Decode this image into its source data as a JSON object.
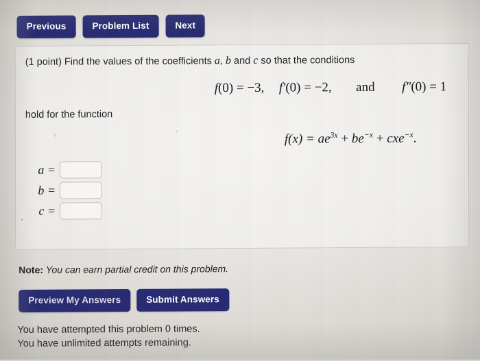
{
  "nav": {
    "previous_label": "Previous",
    "problem_list_label": "Problem List",
    "next_label": "Next"
  },
  "problem": {
    "points_prefix": "(1 point) Find the values of the coefficients",
    "var_a": "a",
    "comma": ",",
    "var_b": "b",
    "and_word": "and",
    "var_c": "c",
    "prompt_suffix": "so that the conditions",
    "conditions": {
      "cond1_fn": "f",
      "cond1_arg": "(0) = −3,",
      "cond2_fn": "f",
      "cond2_prime": "′",
      "cond2_arg": "(0) = −2,",
      "joiner": "and",
      "cond3_fn": "f",
      "cond3_prime": "″",
      "cond3_arg": "(0) = 1",
      "plain_text": "f(0) = −3,   f′(0) = −2,   and   f″(0) = 1"
    },
    "hold_text": "hold for the function",
    "function": {
      "lhs": "f",
      "lhs_arg": "(x) = ",
      "term1_coeff": "ae",
      "term1_exp": "3x",
      "plus1": " + ",
      "term2_coeff": "be",
      "term2_exp": "−x",
      "plus2": " + ",
      "term3_coeff": "cxe",
      "term3_exp": "−x",
      "period": ".",
      "plain_text": "f(x) = ae^{3x} + be^{-x} + cxe^{-x}."
    }
  },
  "answers": [
    {
      "label": "a =",
      "value": "",
      "placeholder": ""
    },
    {
      "label": "b =",
      "value": "",
      "placeholder": ""
    },
    {
      "label": "c =",
      "value": "",
      "placeholder": ""
    }
  ],
  "footer": {
    "note_label": "Note:",
    "note_text": "You can earn partial credit on this problem.",
    "preview_label": "Preview My Answers",
    "submit_label": "Submit Answers",
    "attempts_line1": "You have attempted this problem 0 times.",
    "attempts_line2": "You have unlimited attempts remaining."
  },
  "colors": {
    "button_navy": "#272a72",
    "page_background": "#e9e7e3",
    "panel_background": "#f3f1ee",
    "text": "#1a1a1c"
  }
}
